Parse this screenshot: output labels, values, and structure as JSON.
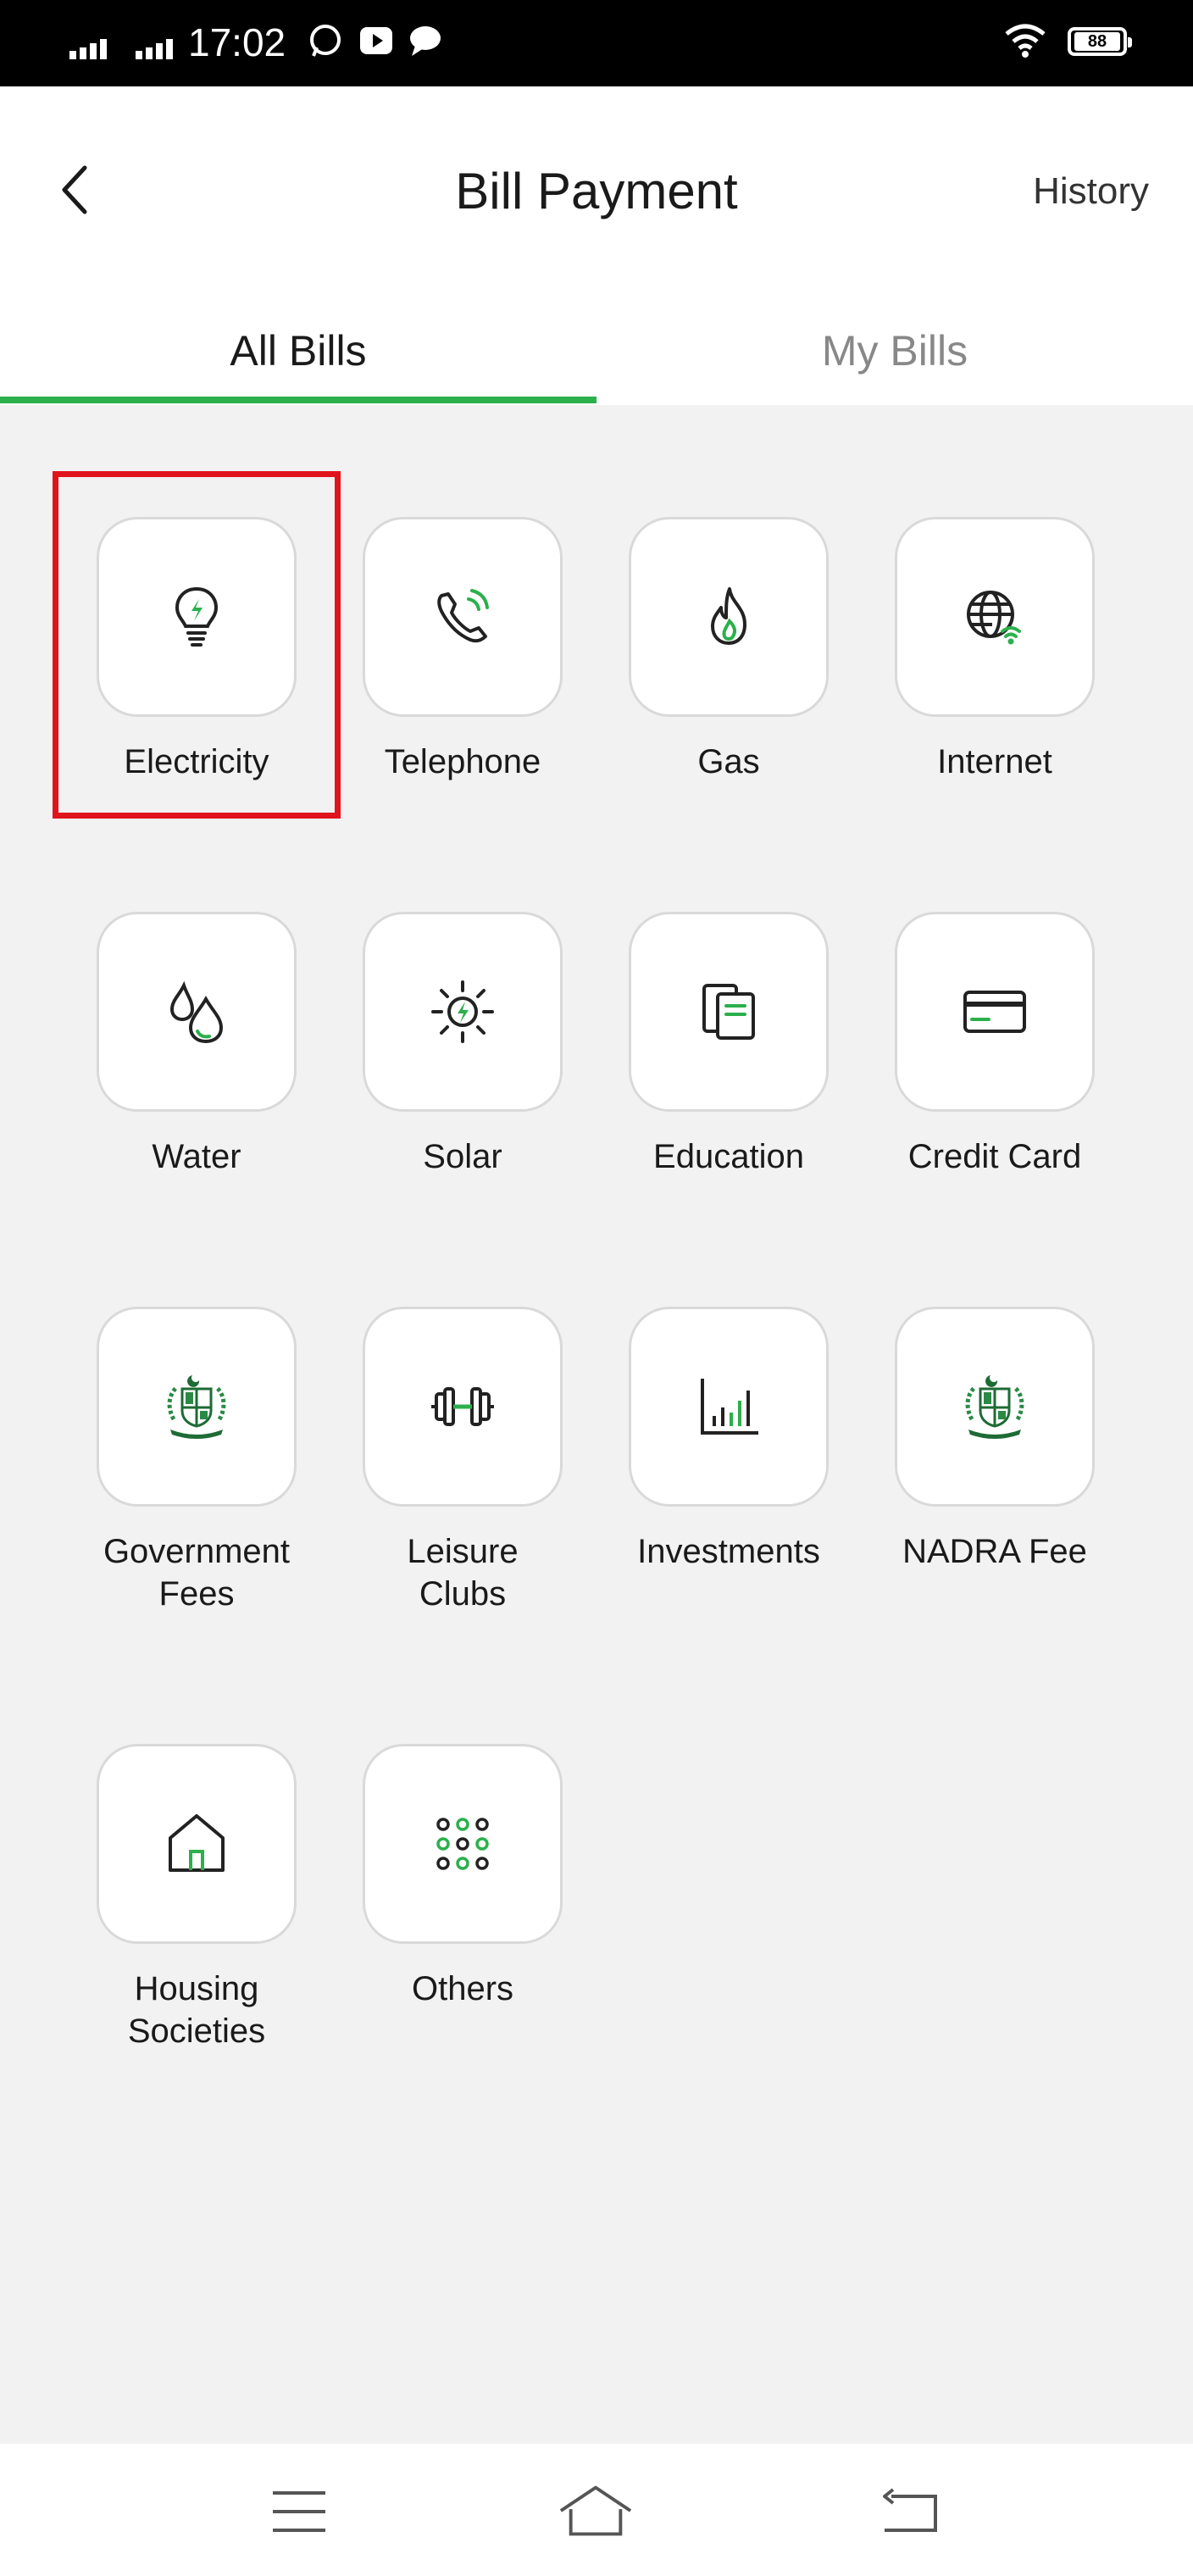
{
  "status_bar": {
    "time": "17:02",
    "battery": "88"
  },
  "header": {
    "title": "Bill Payment",
    "history_label": "History"
  },
  "tabs": [
    {
      "label": "All Bills",
      "active": true
    },
    {
      "label": "My Bills",
      "active": false
    }
  ],
  "accent_color": "#2bb04c",
  "highlight_color": "#e0141d",
  "categories": [
    {
      "label": "Electricity",
      "icon": "lightbulb-icon",
      "highlighted": true
    },
    {
      "label": "Telephone",
      "icon": "phone-icon"
    },
    {
      "label": "Gas",
      "icon": "flame-icon"
    },
    {
      "label": "Internet",
      "icon": "globe-wifi-icon"
    },
    {
      "label": "Water",
      "icon": "water-drop-icon"
    },
    {
      "label": "Solar",
      "icon": "sun-bolt-icon"
    },
    {
      "label": "Education",
      "icon": "books-icon"
    },
    {
      "label": "Credit Card",
      "icon": "credit-card-icon"
    },
    {
      "label": "Government\nFees",
      "icon": "government-emblem-icon"
    },
    {
      "label": "Leisure\nClubs",
      "icon": "dumbbell-icon"
    },
    {
      "label": "Investments",
      "icon": "bar-chart-icon"
    },
    {
      "label": "NADRA Fee",
      "icon": "nadra-emblem-icon"
    },
    {
      "label": "Housing\nSocieties",
      "icon": "house-icon"
    },
    {
      "label": "Others",
      "icon": "grid-dots-icon"
    }
  ]
}
